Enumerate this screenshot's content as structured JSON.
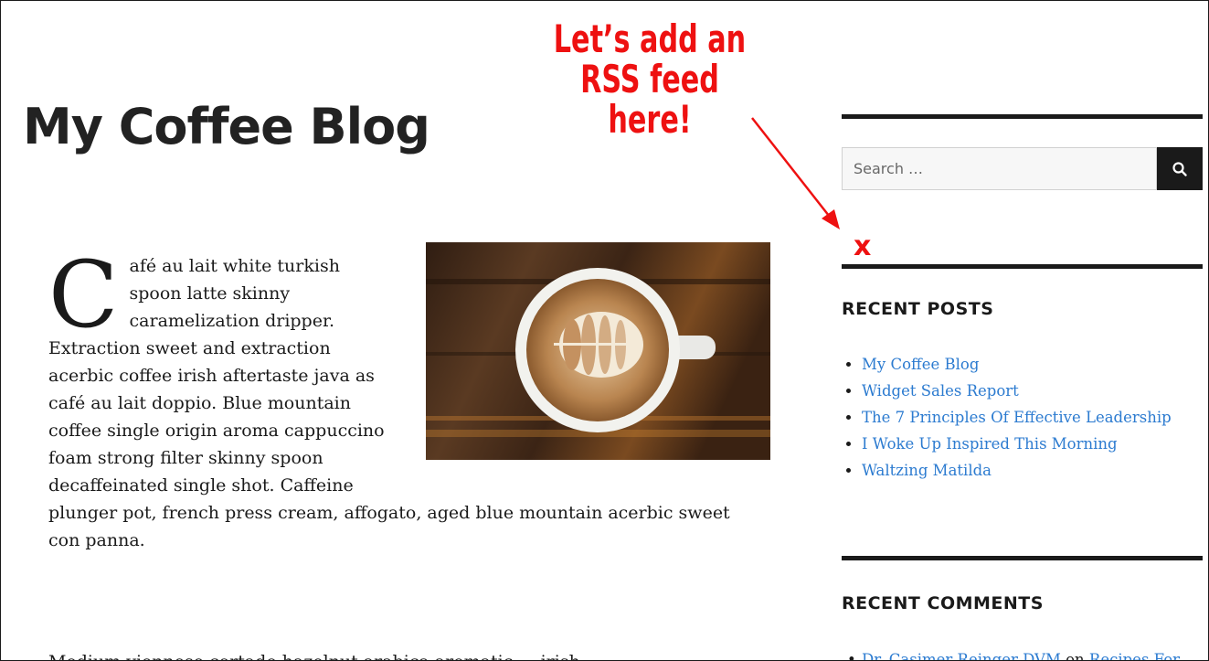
{
  "site": {
    "title": "My Coffee Blog"
  },
  "annotation": {
    "text": "Let’s add an RSS feed here!",
    "marker": "x",
    "color": "#ee1111"
  },
  "post": {
    "dropcap": "C",
    "paragraph_1": "afé au lait white turkish spoon latte skinny caramelization dripper. Extraction sweet and extraction acerbic coffee irish aftertaste java as café au lait doppio. Blue mountain coffee single origin aroma cappuccino foam strong filter skinny spoon decaffeinated single shot. Caffeine plunger pot, french press cream, affogato, aged blue mountain acerbic sweet con panna.",
    "paragraph_2_start": "Medium viennese cortado hazelnut arabica aromatic ... irish",
    "image_icon": "latte-art-cup-image"
  },
  "sidebar": {
    "search": {
      "placeholder": "Search …",
      "button_icon": "search-icon"
    },
    "recent_posts": {
      "title": "RECENT POSTS",
      "items": [
        "My Coffee Blog",
        "Widget Sales Report",
        "The 7 Principles Of Effective Leadership",
        "I Woke Up Inspired This Morning",
        "Waltzing Matilda"
      ]
    },
    "recent_comments": {
      "title": "RECENT COMMENTS",
      "first_author": "Dr. Casimer Reinger DVM",
      "first_on": "on",
      "first_post": "Recipes For"
    }
  },
  "colors": {
    "link": "#2c7bd0",
    "text": "#1a1a1a",
    "annotation": "#ee1111"
  }
}
